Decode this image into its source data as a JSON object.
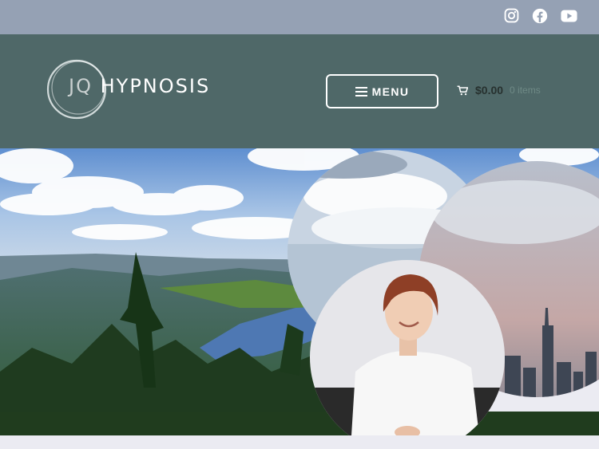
{
  "topbar": {
    "social": [
      "instagram-icon",
      "facebook-icon",
      "youtube-icon"
    ],
    "background": "#95a1b4"
  },
  "header": {
    "background": "#4f6868",
    "logo": {
      "part1": "JQ",
      "part2": "HYPNOSIS"
    },
    "menu_label": "MENU",
    "cart": {
      "amount": "$0.00",
      "items": "0 items",
      "icon": "cart-icon"
    }
  },
  "hero": {
    "description_icons": [
      "forest-lake-landscape",
      "portrait-photo",
      "city-skyline"
    ]
  }
}
